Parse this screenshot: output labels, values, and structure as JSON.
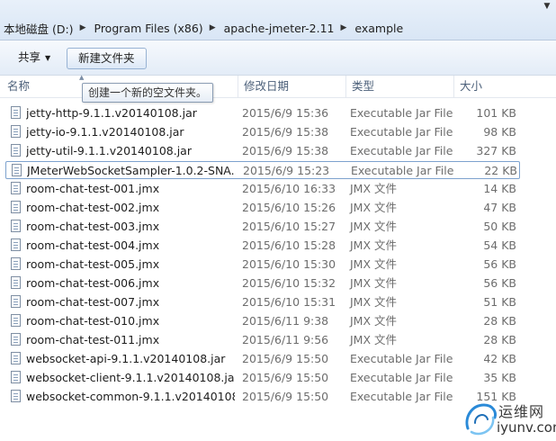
{
  "address_bar": {
    "crumbs": [
      "本地磁盘 (D:)",
      "Program Files (x86)",
      "apache-jmeter-2.11",
      "example"
    ]
  },
  "toolbar": {
    "share_label": "共享",
    "new_folder_label": "新建文件夹"
  },
  "tooltip": "创建一个新的空文件夹。",
  "columns": {
    "name": "名称",
    "date": "修改日期",
    "type": "类型",
    "size": "大小"
  },
  "files": [
    {
      "name": "jetty-http-9.1.1.v20140108.jar",
      "date": "2015/6/9 15:36",
      "type": "Executable Jar File",
      "size": "101 KB"
    },
    {
      "name": "jetty-io-9.1.1.v20140108.jar",
      "date": "2015/6/9 15:38",
      "type": "Executable Jar File",
      "size": "98 KB"
    },
    {
      "name": "jetty-util-9.1.1.v20140108.jar",
      "date": "2015/6/9 15:38",
      "type": "Executable Jar File",
      "size": "327 KB"
    },
    {
      "name": "JMeterWebSocketSampler-1.0.2-SNA...",
      "date": "2015/6/9 15:23",
      "type": "Executable Jar File",
      "size": "22 KB"
    },
    {
      "name": "room-chat-test-001.jmx",
      "date": "2015/6/10 16:33",
      "type": "JMX 文件",
      "size": "14 KB"
    },
    {
      "name": "room-chat-test-002.jmx",
      "date": "2015/6/10 15:26",
      "type": "JMX 文件",
      "size": "47 KB"
    },
    {
      "name": "room-chat-test-003.jmx",
      "date": "2015/6/10 15:27",
      "type": "JMX 文件",
      "size": "50 KB"
    },
    {
      "name": "room-chat-test-004.jmx",
      "date": "2015/6/10 15:28",
      "type": "JMX 文件",
      "size": "54 KB"
    },
    {
      "name": "room-chat-test-005.jmx",
      "date": "2015/6/10 15:30",
      "type": "JMX 文件",
      "size": "56 KB"
    },
    {
      "name": "room-chat-test-006.jmx",
      "date": "2015/6/10 15:32",
      "type": "JMX 文件",
      "size": "56 KB"
    },
    {
      "name": "room-chat-test-007.jmx",
      "date": "2015/6/10 15:31",
      "type": "JMX 文件",
      "size": "51 KB"
    },
    {
      "name": "room-chat-test-010.jmx",
      "date": "2015/6/11 9:38",
      "type": "JMX 文件",
      "size": "28 KB"
    },
    {
      "name": "room-chat-test-011.jmx",
      "date": "2015/6/11 9:56",
      "type": "JMX 文件",
      "size": "28 KB"
    },
    {
      "name": "websocket-api-9.1.1.v20140108.jar",
      "date": "2015/6/9 15:50",
      "type": "Executable Jar File",
      "size": "42 KB"
    },
    {
      "name": "websocket-client-9.1.1.v20140108.jar",
      "date": "2015/6/9 15:50",
      "type": "Executable Jar File",
      "size": "35 KB"
    },
    {
      "name": "websocket-common-9.1.1.v20140108...",
      "date": "2015/6/9 15:50",
      "type": "Executable Jar File",
      "size": "151 KB"
    }
  ],
  "watermark": {
    "cn": "运维网",
    "url": "iyunv.com"
  }
}
